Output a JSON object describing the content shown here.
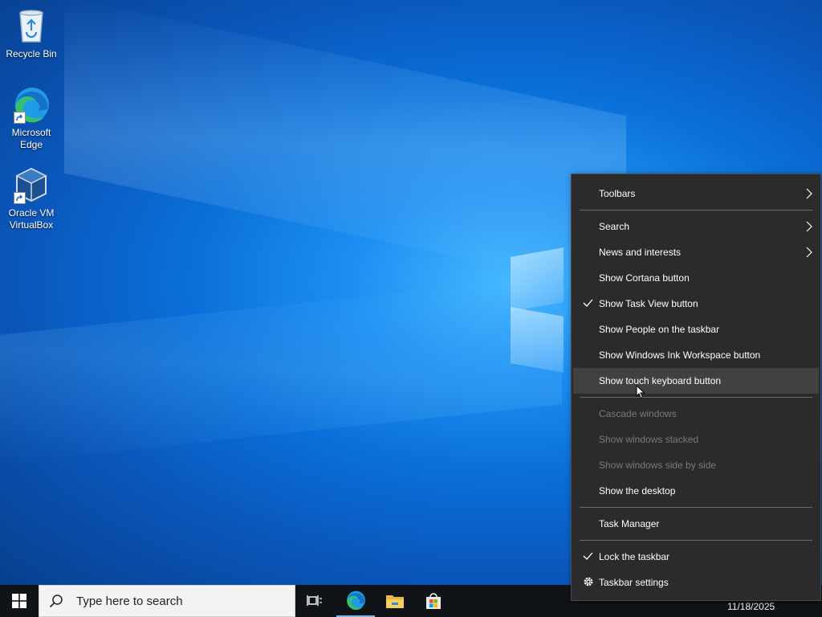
{
  "desktop_icons": [
    {
      "label": "Recycle Bin",
      "icon": "recycle-bin-icon"
    },
    {
      "label": "Microsoft Edge",
      "icon": "edge-icon"
    },
    {
      "label": "Oracle VM VirtualBox",
      "icon": "virtualbox-icon"
    }
  ],
  "taskbar": {
    "search_placeholder": "Type here to search",
    "clock_date": "11/18/2025"
  },
  "context_menu": {
    "items": [
      {
        "label": "Toolbars",
        "submenu": true,
        "checked": false,
        "disabled": false
      },
      {
        "label": "Search",
        "submenu": true,
        "checked": false,
        "disabled": false
      },
      {
        "label": "News and interests",
        "submenu": true,
        "checked": false,
        "disabled": false
      },
      {
        "label": "Show Cortana button",
        "checked": false,
        "disabled": false
      },
      {
        "label": "Show Task View button",
        "checked": true,
        "disabled": false
      },
      {
        "label": "Show People on the taskbar",
        "checked": false,
        "disabled": false
      },
      {
        "label": "Show Windows Ink Workspace button",
        "checked": false,
        "disabled": false
      },
      {
        "label": "Show touch keyboard button",
        "checked": false,
        "disabled": false,
        "hovered": true
      },
      {
        "label": "Cascade windows",
        "checked": false,
        "disabled": true
      },
      {
        "label": "Show windows stacked",
        "checked": false,
        "disabled": true
      },
      {
        "label": "Show windows side by side",
        "checked": false,
        "disabled": true
      },
      {
        "label": "Show the desktop",
        "checked": false,
        "disabled": false
      },
      {
        "label": "Task Manager",
        "checked": false,
        "disabled": false
      },
      {
        "label": "Lock the taskbar",
        "checked": true,
        "disabled": false
      },
      {
        "label": "Taskbar settings",
        "icon": "gear-icon",
        "checked": false,
        "disabled": false
      }
    ]
  },
  "colors": {
    "menu_bg": "#2b2b2b",
    "menu_hover": "#414141",
    "taskbar_bg": "#101418",
    "accent": "#0a6fd8"
  }
}
